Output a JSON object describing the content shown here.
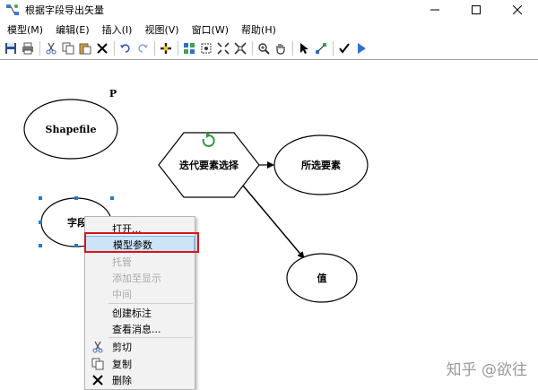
{
  "window": {
    "title": "根据字段导出矢量",
    "controls": [
      "minimize",
      "maximize",
      "close"
    ]
  },
  "menu": [
    "模型(M)",
    "编辑(E)",
    "插入(I)",
    "视图(V)",
    "窗口(W)",
    "帮助(H)"
  ],
  "toolbar": {
    "buttons": [
      "save-icon",
      "print-icon",
      "cut-icon",
      "copy-icon",
      "paste-icon",
      "delete-icon",
      "undo-icon",
      "redo-icon",
      "add-data-icon",
      "auto-layout-icon",
      "full-extent-icon",
      "zoom-in-fixed-icon",
      "zoom-out-fixed-icon",
      "zoom-in-icon",
      "pan-icon",
      "select-icon",
      "connect-icon",
      "validate-icon",
      "run-icon"
    ]
  },
  "diagram": {
    "nodes": {
      "shapefile": "Shapefile",
      "field": "字段",
      "iterator": "迭代要素选择",
      "selected": "所选要素",
      "value": "值"
    },
    "parameter_marker": "P",
    "accent_colors": {
      "node_stroke": "#000000",
      "selection_handle": "#1e7bd6",
      "iterator_glyph": "#2e9a3e",
      "highlight_box": "#d6141c"
    }
  },
  "context_menu": {
    "items": [
      {
        "label": "打开...",
        "enabled": true,
        "icon": null
      },
      {
        "label": "模型参数",
        "enabled": true,
        "icon": null,
        "highlighted": true
      },
      {
        "label": "托管",
        "enabled": false,
        "icon": null
      },
      {
        "label": "添加至显示",
        "enabled": false,
        "icon": null
      },
      {
        "label": "中间",
        "enabled": false,
        "icon": null
      },
      {
        "label": "创建标注",
        "enabled": true,
        "icon": null
      },
      {
        "label": "查看消息...",
        "enabled": true,
        "icon": null
      },
      {
        "label": "剪切",
        "enabled": true,
        "icon": "cut-icon"
      },
      {
        "label": "复制",
        "enabled": true,
        "icon": "copy-icon"
      },
      {
        "label": "删除",
        "enabled": true,
        "icon": "delete-icon"
      }
    ]
  },
  "watermark": "知乎 @欲往"
}
